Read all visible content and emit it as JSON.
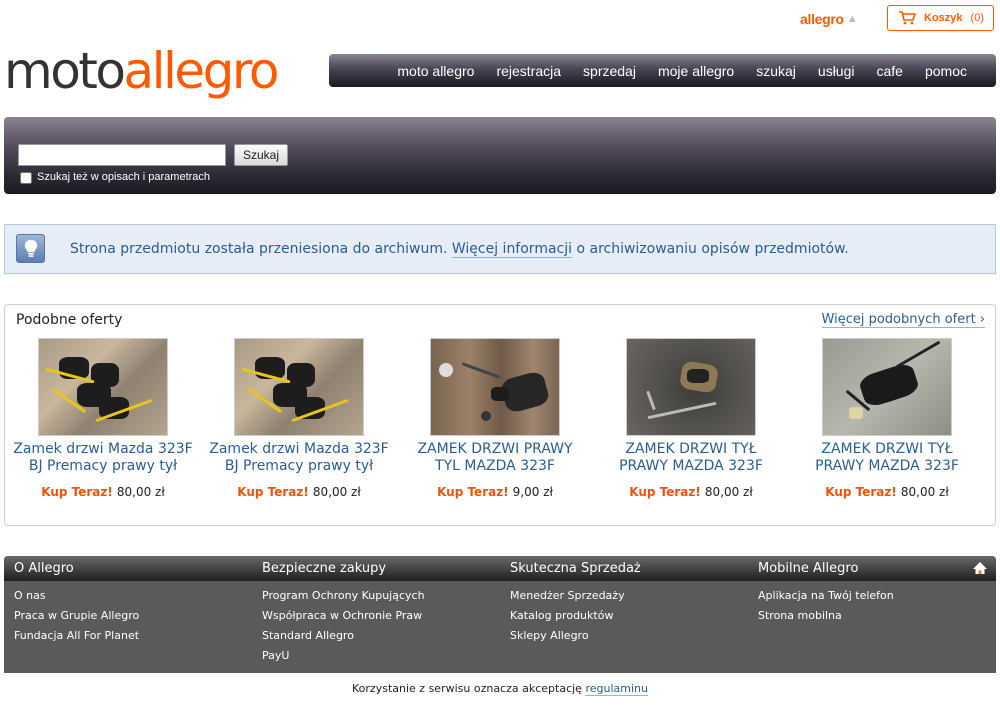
{
  "header": {
    "allegro_logo_small": "allegro",
    "cart_label": "Koszyk",
    "cart_count": "(0)"
  },
  "logo": {
    "part1": "moto",
    "part2": "allegro"
  },
  "nav": {
    "items": [
      "moto allegro",
      "rejestracja",
      "sprzedaj",
      "moje allegro",
      "szukaj",
      "usługi",
      "cafe",
      "pomoc"
    ]
  },
  "search": {
    "value": "",
    "button_label": "Szukaj",
    "checkbox_label": "Szukaj też w opisach i parametrach",
    "checkbox_checked": false
  },
  "info": {
    "text_before": "Strona przedmiotu została przeniesiona do archiwum.",
    "link_text": "Więcej informacji",
    "text_after": "o archiwizowaniu opisów przedmiotów."
  },
  "offers": {
    "title": "Podobne oferty",
    "more_link": "Więcej podobnych ofert ›",
    "buy_label": "Kup Teraz!",
    "items": [
      {
        "title": "Zamek drzwi Mazda 323F BJ Premacy prawy tył",
        "price": "80,00 zł"
      },
      {
        "title": "Zamek drzwi Mazda 323F BJ Premacy prawy tył",
        "price": "80,00 zł"
      },
      {
        "title": "ZAMEK DRZWI PRAWY TYL MAZDA 323F",
        "price": "9,00 zł"
      },
      {
        "title": "ZAMEK DRZWI TYŁ PRAWY MAZDA 323F",
        "price": "80,00 zł"
      },
      {
        "title": "ZAMEK DRZWI TYŁ PRAWY MAZDA 323F",
        "price": "80,00 zł"
      }
    ]
  },
  "footer": {
    "columns": [
      {
        "title": "O Allegro",
        "links": [
          "O nas",
          "Praca w Grupie Allegro",
          "Fundacja All For Planet"
        ]
      },
      {
        "title": "Bezpieczne zakupy",
        "links": [
          "Program Ochrony Kupujących",
          "Współpraca w Ochronie Praw",
          "Standard Allegro",
          "PayU"
        ]
      },
      {
        "title": "Skuteczna Sprzedaż",
        "links": [
          "Menedżer Sprzedaży",
          "Katalog produktów",
          "Sklepy Allegro"
        ]
      },
      {
        "title": "Mobilne Allegro",
        "links": [
          "Aplikacja na Twój telefon",
          "Strona mobilna"
        ]
      }
    ],
    "note_text": "Korzystanie z serwisu oznacza akceptację",
    "note_link": "regulaminu"
  },
  "colors": {
    "brand_orange": "#ff5a00",
    "link_blue": "#2b5d91",
    "info_bg": "#e6edf6",
    "footer_bg": "#5a5a5a"
  },
  "icons": [
    "cart-icon",
    "arrow-up-icon",
    "lightbulb-icon",
    "home-icon"
  ]
}
